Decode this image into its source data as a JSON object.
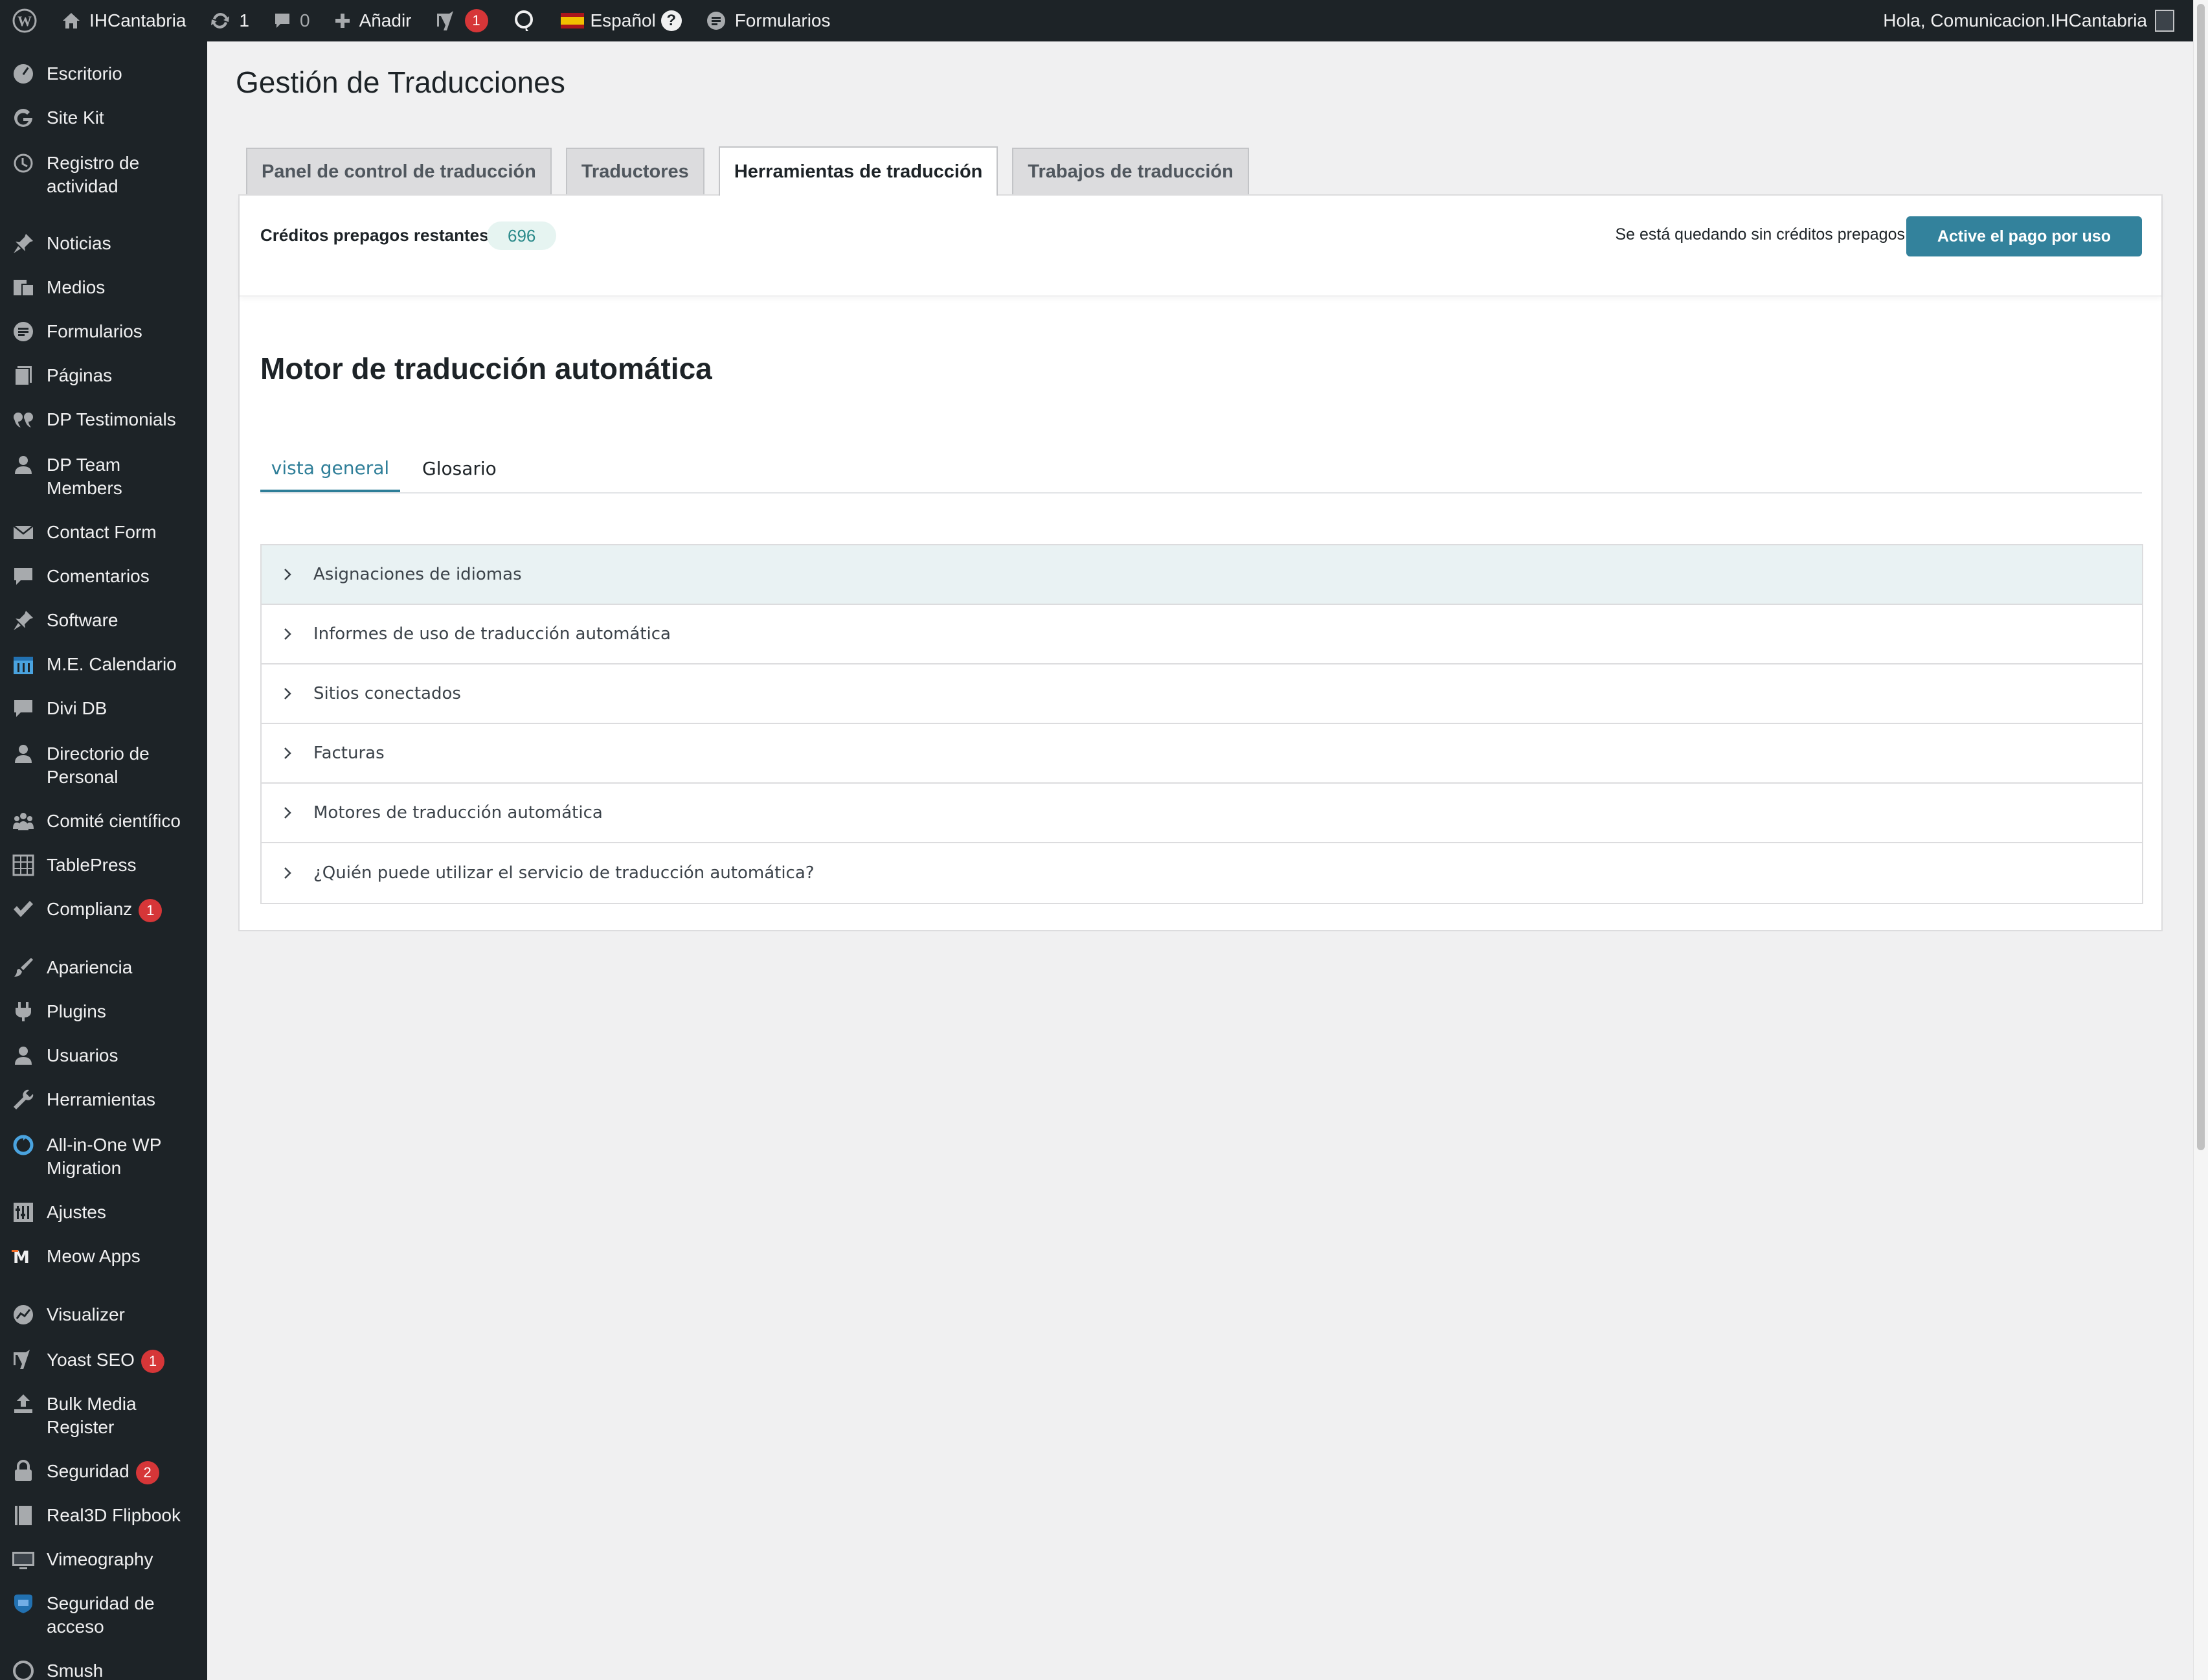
{
  "adminbar": {
    "site_name": "IHCantabria",
    "updates_count": "1",
    "comments_count": "0",
    "add_new_label": "Añadir",
    "yoast_badge": "1",
    "language_label": "Español",
    "help_glyph": "?",
    "forms_label": "Formularios",
    "greeting": "Hola, Comunicacion.IHCantabria"
  },
  "sidebar": {
    "items": [
      {
        "label": "Escritorio",
        "icon": "dashboard-icon"
      },
      {
        "label": "Site Kit",
        "icon": "google-g-icon"
      },
      {
        "label": "Registro de actividad",
        "icon": "history-icon"
      },
      {
        "label": "Noticias",
        "icon": "pin-icon"
      },
      {
        "label": "Medios",
        "icon": "media-icon"
      },
      {
        "label": "Formularios",
        "icon": "forms-icon"
      },
      {
        "label": "Páginas",
        "icon": "pages-icon"
      },
      {
        "label": "DP Testimonials",
        "icon": "quote-icon"
      },
      {
        "label": "DP Team Members",
        "icon": "person-icon"
      },
      {
        "label": "Contact Form",
        "icon": "mail-icon"
      },
      {
        "label": "Comentarios",
        "icon": "comment-icon"
      },
      {
        "label": "Software",
        "icon": "pin-icon"
      },
      {
        "label": "M.E. Calendario",
        "icon": "calendar-icon"
      },
      {
        "label": "Divi DB",
        "icon": "comment-icon"
      },
      {
        "label": "Directorio de Personal",
        "icon": "person-icon"
      },
      {
        "label": "Comité científico",
        "icon": "group-icon"
      },
      {
        "label": "TablePress",
        "icon": "table-icon"
      },
      {
        "label": "Complianz",
        "icon": "check-icon",
        "badge": "1"
      },
      {
        "label": "Apariencia",
        "icon": "brush-icon"
      },
      {
        "label": "Plugins",
        "icon": "plug-icon"
      },
      {
        "label": "Usuarios",
        "icon": "person-icon"
      },
      {
        "label": "Herramientas",
        "icon": "wrench-icon"
      },
      {
        "label": "All-in-One WP Migration",
        "icon": "migration-icon"
      },
      {
        "label": "Ajustes",
        "icon": "settings-icon"
      },
      {
        "label": "Meow Apps",
        "icon": "meow-icon"
      },
      {
        "label": "Visualizer",
        "icon": "chart-icon"
      },
      {
        "label": "Yoast SEO",
        "icon": "yoast-icon",
        "badge": "1"
      },
      {
        "label": "Bulk Media Register",
        "icon": "upload-icon"
      },
      {
        "label": "Seguridad",
        "icon": "lock-icon",
        "badge": "2"
      },
      {
        "label": "Real3D Flipbook",
        "icon": "book-icon"
      },
      {
        "label": "Vimeography",
        "icon": "video-icon"
      },
      {
        "label": "Seguridad de acceso",
        "icon": "shield-icon"
      },
      {
        "label": "Smush",
        "icon": "smush-icon"
      }
    ]
  },
  "page": {
    "title": "Gestión de Traducciones",
    "tabs": [
      {
        "label": "Panel de control de traducción"
      },
      {
        "label": "Traductores"
      },
      {
        "label": "Herramientas de traducción"
      },
      {
        "label": "Trabajos de traducción"
      }
    ]
  },
  "credits": {
    "label": "Créditos prepagos restantes",
    "value": "696",
    "warning": "Se está quedando sin créditos prepagos",
    "button_label": "Active el pago por uso"
  },
  "engine": {
    "title": "Motor de traducción automática",
    "subtabs": [
      {
        "label": "vista general"
      },
      {
        "label": "Glosario"
      }
    ],
    "sections": [
      {
        "label": "Asignaciones de idiomas"
      },
      {
        "label": "Informes de uso de traducción automática"
      },
      {
        "label": "Sitios conectados"
      },
      {
        "label": "Facturas"
      },
      {
        "label": "Motores de traducción automática"
      },
      {
        "label": "¿Quién puede utilizar el servicio de traducción automática?"
      }
    ]
  },
  "colors": {
    "sidebar_bg": "#1d2327",
    "accent": "#33829c",
    "badge": "#d63638"
  }
}
